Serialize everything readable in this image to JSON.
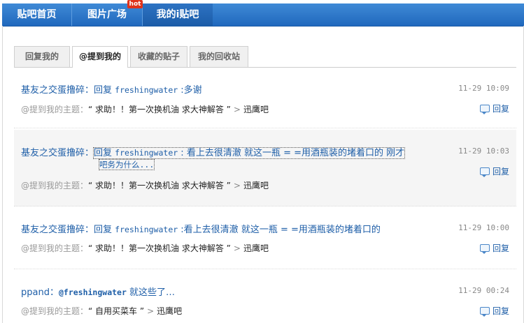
{
  "nav": {
    "tabs": [
      {
        "label": "贴吧首页"
      },
      {
        "label": "图片广场"
      },
      {
        "label": "我的i贴吧"
      }
    ],
    "hot_badge": "hot"
  },
  "subtabs": [
    "回复我的",
    "@提到我的",
    "收藏的贴子",
    "我的回收站"
  ],
  "labels": {
    "topic_prefix": "@提到我的主题：",
    "reply": "回复"
  },
  "items": [
    {
      "author": "基友之交蛋撸碎：",
      "reply_word": "回复 ",
      "target": "freshingwater",
      "content": " :多谢",
      "time": "11-29 10:09",
      "topic": "“ 求助！！第一次换机油 求大神解答 ”",
      "bar": "迅鹰吧"
    },
    {
      "author": "基友之交蛋撸碎：",
      "reply_word": "回复 ",
      "target": "freshingwater",
      "content": " : 看上去很清澈 就这一瓶 = =用酒瓶装的堵着口的 刚才",
      "content2": "吧务为什么...",
      "time": "11-29 10:03",
      "topic": "“ 求助！！第一次换机油 求大神解答 ”",
      "bar": "迅鹰吧"
    },
    {
      "author": "基友之交蛋撸碎：",
      "reply_word": "回复 ",
      "target": "freshingwater",
      "content": " :看上去很清澈 就这一瓶 = =用酒瓶装的堵着口的",
      "time": "11-29 10:00",
      "topic": "“ 求助！！第一次换机油 求大神解答 ”",
      "bar": "迅鹰吧"
    },
    {
      "author": "ppand：",
      "mention": "@freshingwater",
      "content": " 就这些了…",
      "time": "11-29 00:24",
      "topic": "“ 自用买菜车 ”",
      "bar": "迅鹰吧"
    }
  ]
}
